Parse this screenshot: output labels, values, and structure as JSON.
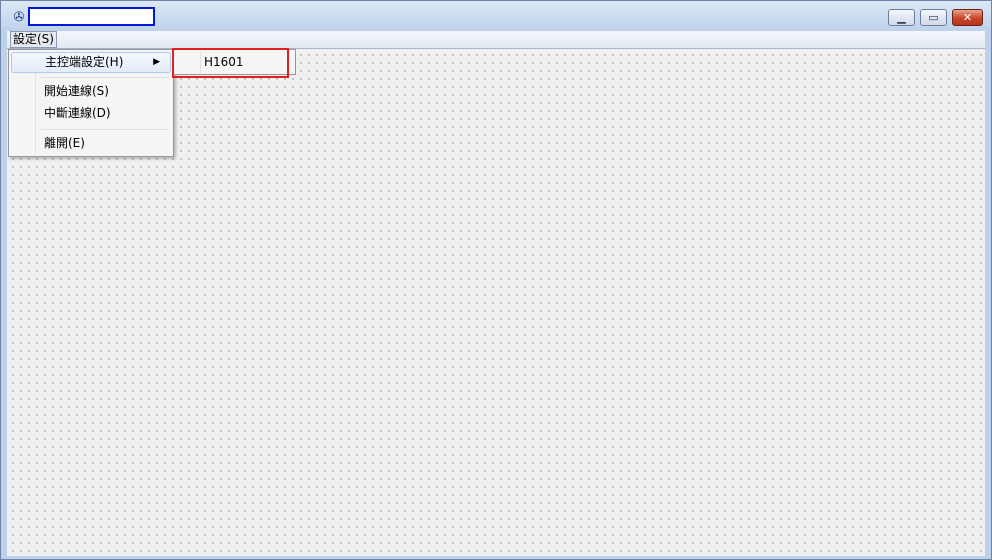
{
  "menubar": {
    "settings_label": "設定(S)"
  },
  "dropdown": {
    "items": [
      {
        "label": "主控端設定(H)"
      },
      {
        "label": "開始連線(S)"
      },
      {
        "label": "中斷連線(D)"
      },
      {
        "label": "離開(E)"
      }
    ]
  },
  "submenu": {
    "items": [
      {
        "label": "H1601"
      }
    ]
  },
  "window": {
    "app_icon": "app-icon"
  },
  "colors": {
    "highlight_box": "#e02020",
    "title_box_border": "#0019d8"
  }
}
